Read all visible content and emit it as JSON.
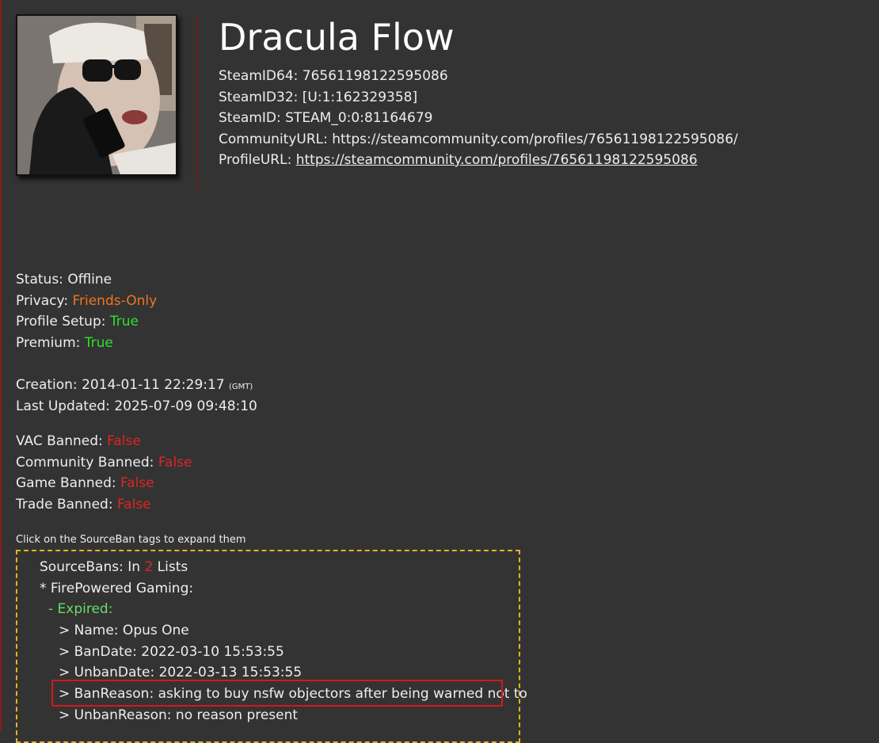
{
  "profile": {
    "name": "Dracula Flow",
    "ids": {
      "steamid64": {
        "label": "SteamID64:",
        "value": "76561198122595086"
      },
      "steamid32": {
        "label": "SteamID32:",
        "value": "[U:1:162329358]"
      },
      "steamid": {
        "label": "SteamID:",
        "value": "STEAM_0:0:81164679"
      },
      "community_url": {
        "label": "CommunityURL:",
        "value": "https://steamcommunity.com/profiles/76561198122595086/"
      },
      "profile_url": {
        "label": "ProfileURL:",
        "value": "https://steamcommunity.com/profiles/76561198122595086"
      }
    }
  },
  "status": {
    "status": {
      "label": "Status:",
      "value": "Offline"
    },
    "privacy": {
      "label": "Privacy:",
      "value": "Friends-Only"
    },
    "profile_setup": {
      "label": "Profile Setup:",
      "value": "True"
    },
    "premium": {
      "label": "Premium:",
      "value": "True"
    }
  },
  "dates": {
    "creation": {
      "label": "Creation:",
      "value": "2014-01-11 22:29:17",
      "tz": "(GMT)"
    },
    "last_updated": {
      "label": "Last Updated:",
      "value": "2025-07-09 09:48:10"
    }
  },
  "bans": {
    "vac": {
      "label": "VAC Banned:",
      "value": "False"
    },
    "community": {
      "label": "Community Banned:",
      "value": "False"
    },
    "game": {
      "label": "Game Banned:",
      "value": "False"
    },
    "trade": {
      "label": "Trade Banned:",
      "value": "False"
    }
  },
  "sourcebans": {
    "hint": "Click on the SourceBan tags to expand them",
    "header_prefix": "SourceBans: In ",
    "list_count": "2",
    "header_suffix": " Lists",
    "server": "* FirePowered Gaming:",
    "state": "- Expired:",
    "entries": {
      "name": "> Name: Opus One",
      "ban_date": "> BanDate: 2022-03-10 15:53:55",
      "unban_date": "> UnbanDate: 2022-03-13 15:53:55",
      "ban_reason": "> BanReason: asking to buy nsfw objectors after being warned not to",
      "unban_reason": "> UnbanReason: no reason present"
    }
  },
  "colors": {
    "background": "#333333",
    "orange": "#f07520",
    "green": "#2fe02f",
    "red": "#e02424",
    "box_border": "#e8b020",
    "highlight": "#d11a1a"
  }
}
